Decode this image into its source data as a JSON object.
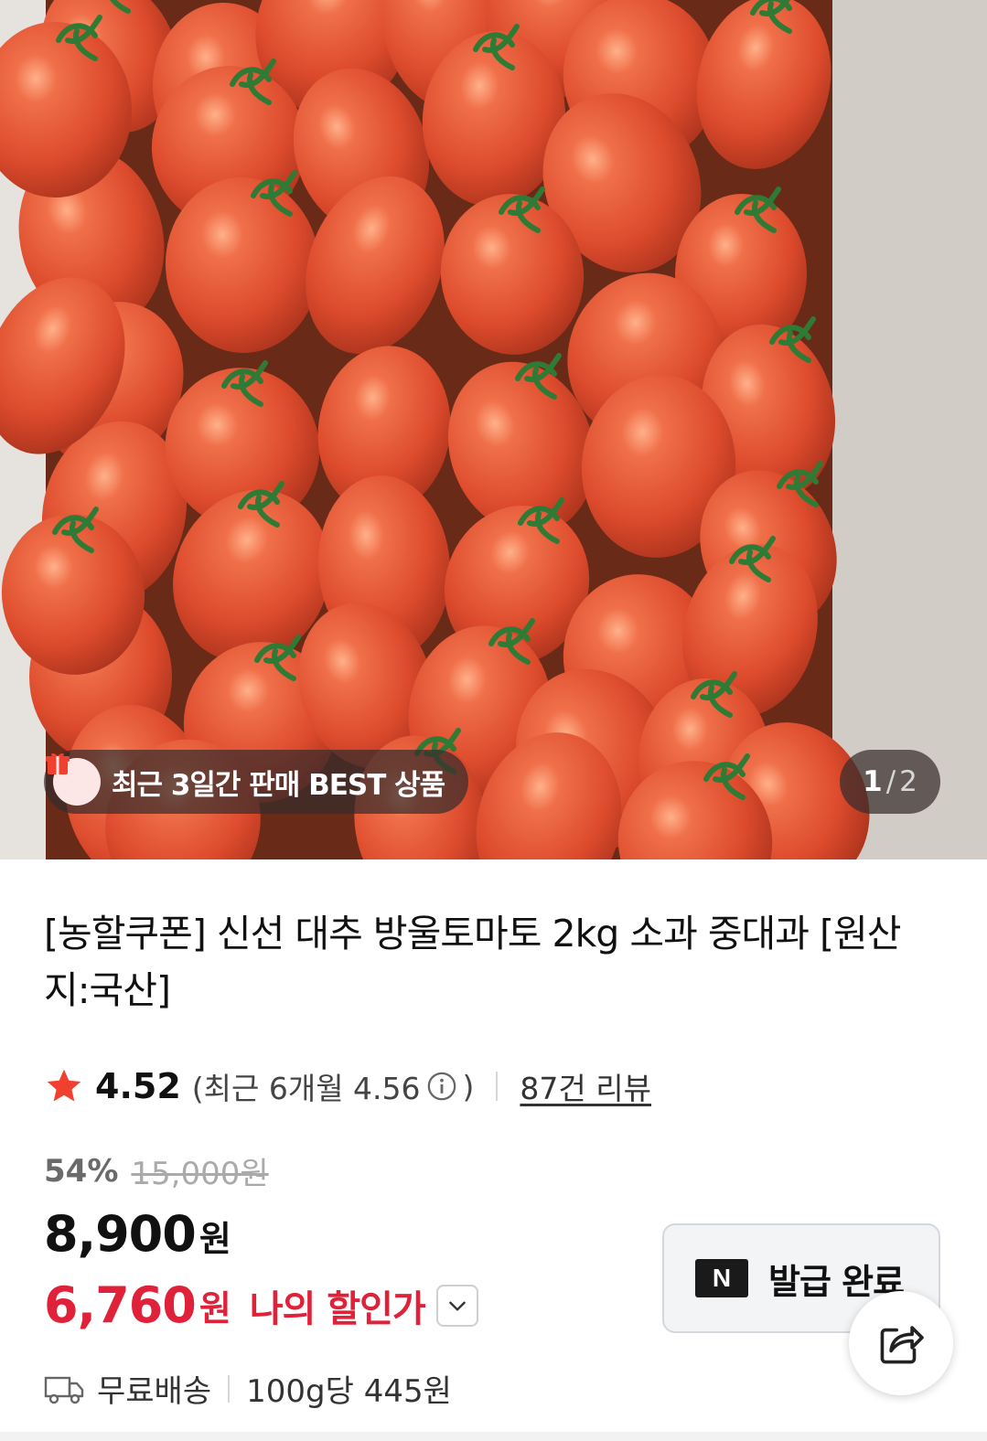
{
  "hero": {
    "image_subject": "cherry-tomatoes-in-box",
    "badge_text": "최근 3일간 판매 BEST 상품",
    "pager_current": "1",
    "pager_separator": "/",
    "pager_total": "2"
  },
  "product": {
    "title": "[농할쿠폰] 신선 대추 방울토마토 2kg 소과 중대과 [원산지:국산]"
  },
  "rating": {
    "score": "4.52",
    "recent_label": "(최근 6개월 4.56",
    "recent_close": ")",
    "reviews": "87건 리뷰"
  },
  "pricing": {
    "discount_pct": "54%",
    "original_price": "15,000원",
    "sale_amount": "8,900",
    "won": "원",
    "my_amount": "6,760",
    "my_label": "나의 할인가"
  },
  "coupon": {
    "logo": "N",
    "label": "발급 완료"
  },
  "shipping": {
    "free": "무료배송",
    "unit_price": "100g당 445원"
  },
  "colors": {
    "accent_red": "#e0213a",
    "star": "#f2402f",
    "tomato": "#e8553a"
  }
}
